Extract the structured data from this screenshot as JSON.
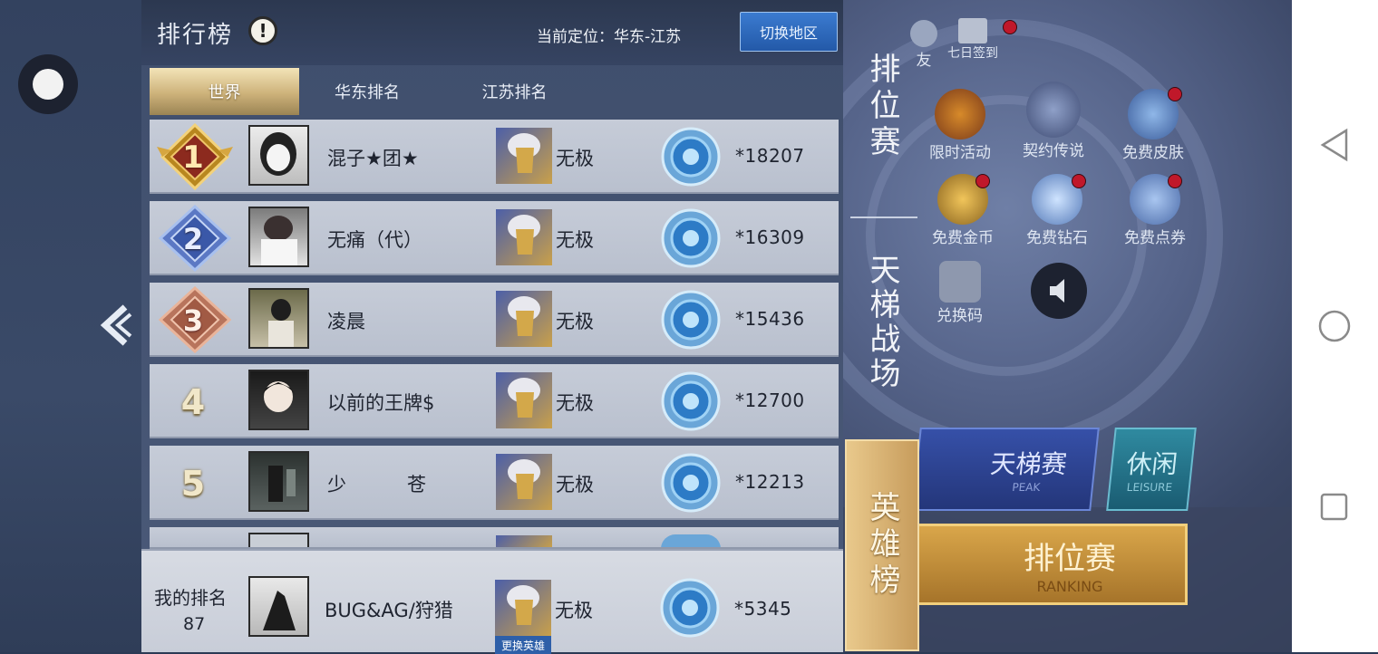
{
  "panel": {
    "title": "排行榜",
    "info_icon": "!",
    "location": "当前定位：华东-江苏",
    "switch_button": "切换地区"
  },
  "tabs": [
    {
      "label": "世界",
      "active": true
    },
    {
      "label": "华东排名",
      "active": false
    },
    {
      "label": "江苏排名",
      "active": false
    }
  ],
  "rows": [
    {
      "rank": "1",
      "name": "混子★团★",
      "hero_tier": "无极",
      "score": "*18207"
    },
    {
      "rank": "2",
      "name": "无痛（代）",
      "hero_tier": "无极",
      "score": "*16309"
    },
    {
      "rank": "3",
      "name": "凌晨",
      "hero_tier": "无极",
      "score": "*15436"
    },
    {
      "rank": "4",
      "name": "以前的王牌$",
      "hero_tier": "无极",
      "score": "*12700"
    },
    {
      "rank": "5",
      "name": "少　　　苍",
      "hero_tier": "无极",
      "score": "*12213"
    }
  ],
  "my_rank": {
    "label": "我的排名",
    "rank": "87",
    "name": "BUG&AG/狩猎",
    "hero_tier": "无极",
    "change_hero": "更换英雄",
    "score": "*5345"
  },
  "category_tabs": [
    {
      "label": "排位赛",
      "active": false
    },
    {
      "label": "天梯战场",
      "active": false
    },
    {
      "label": "英雄榜",
      "active": true
    }
  ],
  "background": {
    "top_labels": [
      "友",
      "七日签到"
    ],
    "activities": [
      "限时活动",
      "契约传说",
      "免费皮肤",
      "免费金币",
      "免费钻石",
      "免费点券",
      "兑换码"
    ],
    "mode_ladder": "天梯赛",
    "mode_ladder_sub": "PEAK",
    "mode_leisure": "休闲",
    "mode_leisure_sub": "LEISURE",
    "mode_ranking": "排位赛",
    "mode_ranking_sub": "RANKING"
  },
  "colors": {
    "panel_bg": "#4b5a79",
    "row_bg": "#c6ccd8",
    "tab_active": "#cdb27a",
    "switch_button": "#2359a8",
    "category_active": "#d9b374"
  }
}
